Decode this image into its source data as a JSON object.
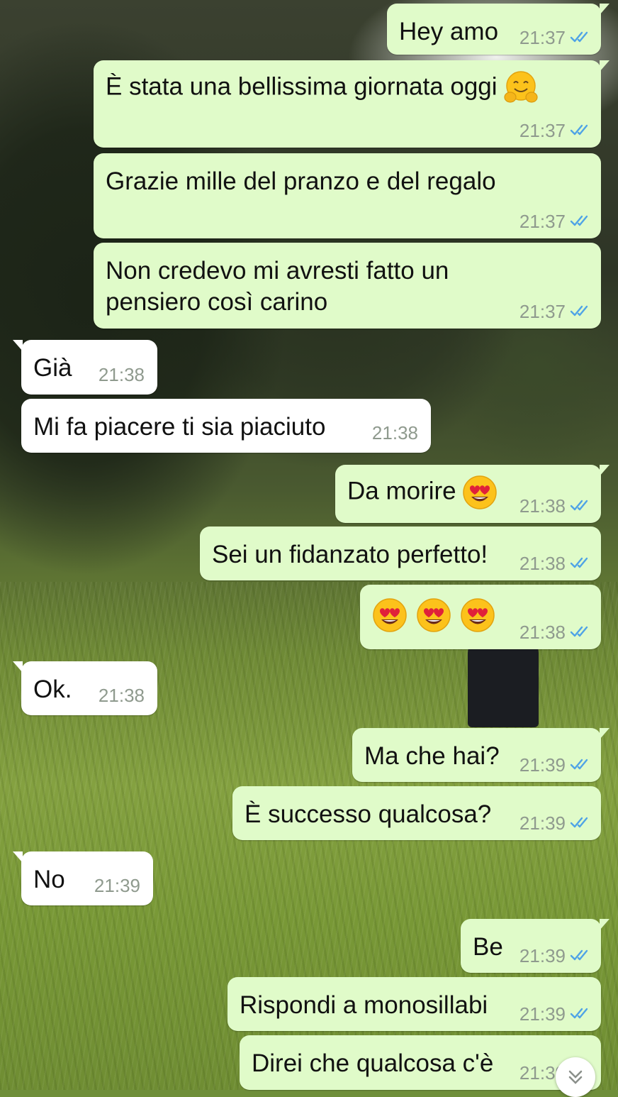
{
  "colors": {
    "outgoing_bubble": "#e0fbc9",
    "incoming_bubble": "#ffffff",
    "read_tick": "#4fa3e6",
    "timestamp": "#8f9a8e"
  },
  "messages": [
    {
      "dir": "out",
      "text": "Hey amo",
      "time": "21:37",
      "status": "read"
    },
    {
      "dir": "out",
      "text": "È stata una bellissima giornata oggi",
      "emoji": [
        "hugging-face"
      ],
      "time": "21:37",
      "status": "read"
    },
    {
      "dir": "out",
      "text": "Grazie mille del pranzo e del regalo",
      "time": "21:37",
      "status": "read"
    },
    {
      "dir": "out",
      "text": "Non credevo mi avresti fatto un pensiero così carino",
      "time": "21:37",
      "status": "read"
    },
    {
      "dir": "in",
      "text": "Già",
      "time": "21:38"
    },
    {
      "dir": "in",
      "text": "Mi fa piacere ti sia piaciuto",
      "time": "21:38"
    },
    {
      "dir": "out",
      "text": "Da morire",
      "emoji": [
        "heart-eyes"
      ],
      "time": "21:38",
      "status": "read"
    },
    {
      "dir": "out",
      "text": "Sei un fidanzato perfetto!",
      "time": "21:38",
      "status": "read"
    },
    {
      "dir": "out",
      "text": "",
      "emoji": [
        "heart-eyes",
        "heart-eyes",
        "heart-eyes"
      ],
      "time": "21:38",
      "status": "read"
    },
    {
      "dir": "in",
      "text": "Ok.",
      "time": "21:38"
    },
    {
      "dir": "out",
      "text": "Ma che hai?",
      "time": "21:39",
      "status": "read"
    },
    {
      "dir": "out",
      "text": "È successo qualcosa?",
      "time": "21:39",
      "status": "read"
    },
    {
      "dir": "in",
      "text": "No",
      "time": "21:39"
    },
    {
      "dir": "out",
      "text": "Be",
      "time": "21:39",
      "status": "read"
    },
    {
      "dir": "out",
      "text": "Rispondi a monosillabi",
      "time": "21:39",
      "status": "read"
    },
    {
      "dir": "out",
      "text": "Direi che qualcosa c'è",
      "time": "21:39",
      "status": "read"
    }
  ],
  "scroll_button_icon": "chevron-double-down-icon"
}
